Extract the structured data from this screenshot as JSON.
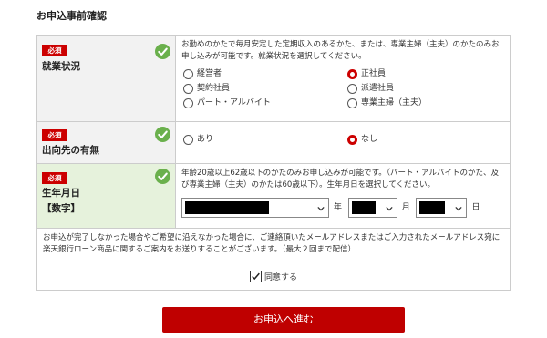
{
  "page": {
    "heading": "お申込事前確認"
  },
  "colors": {
    "accent": "#bf0000",
    "check_green": "#6ab04c"
  },
  "form": {
    "employment": {
      "required_badge": "必須",
      "label": "就業状況",
      "description": "お勤めのかたで毎月安定した定期収入のあるかた、または、専業主婦（主夫）のかたのみお申し込みが可能です。就業状況を選択してください。",
      "options": [
        {
          "label": "経営者",
          "selected": false
        },
        {
          "label": "正社員",
          "selected": true
        },
        {
          "label": "契約社員",
          "selected": false
        },
        {
          "label": "派遣社員",
          "selected": false
        },
        {
          "label": "パート・アルバイト",
          "selected": false
        },
        {
          "label": "専業主婦（主夫）",
          "selected": false
        }
      ]
    },
    "secondment": {
      "required_badge": "必須",
      "label": "出向先の有無",
      "options": [
        {
          "label": "あり",
          "selected": false
        },
        {
          "label": "なし",
          "selected": true
        }
      ]
    },
    "birthdate": {
      "required_badge": "必須",
      "label": "生年月日",
      "sublabel": "【数字】",
      "description": "年齢20歳以上62歳以下のかたのみお申し込みが可能です。（パート・アルバイトのかた、及び専業主婦（主夫）のかたは60歳以下）。生年月日を選択してください。",
      "year_unit": "年",
      "month_unit": "月",
      "day_unit": "日"
    },
    "notice": "お申込が完了しなかった場合やご希望に沿えなかった場合に、ご連絡頂いたメールアドレスまたはご入力されたメールアドレス宛に楽天銀行ローン商品に関するご案内をお送りすることがございます。（最大２回まで配信）",
    "agree_label": "同意する",
    "agree_checked": true
  },
  "submit_label": "お申込へ進む"
}
